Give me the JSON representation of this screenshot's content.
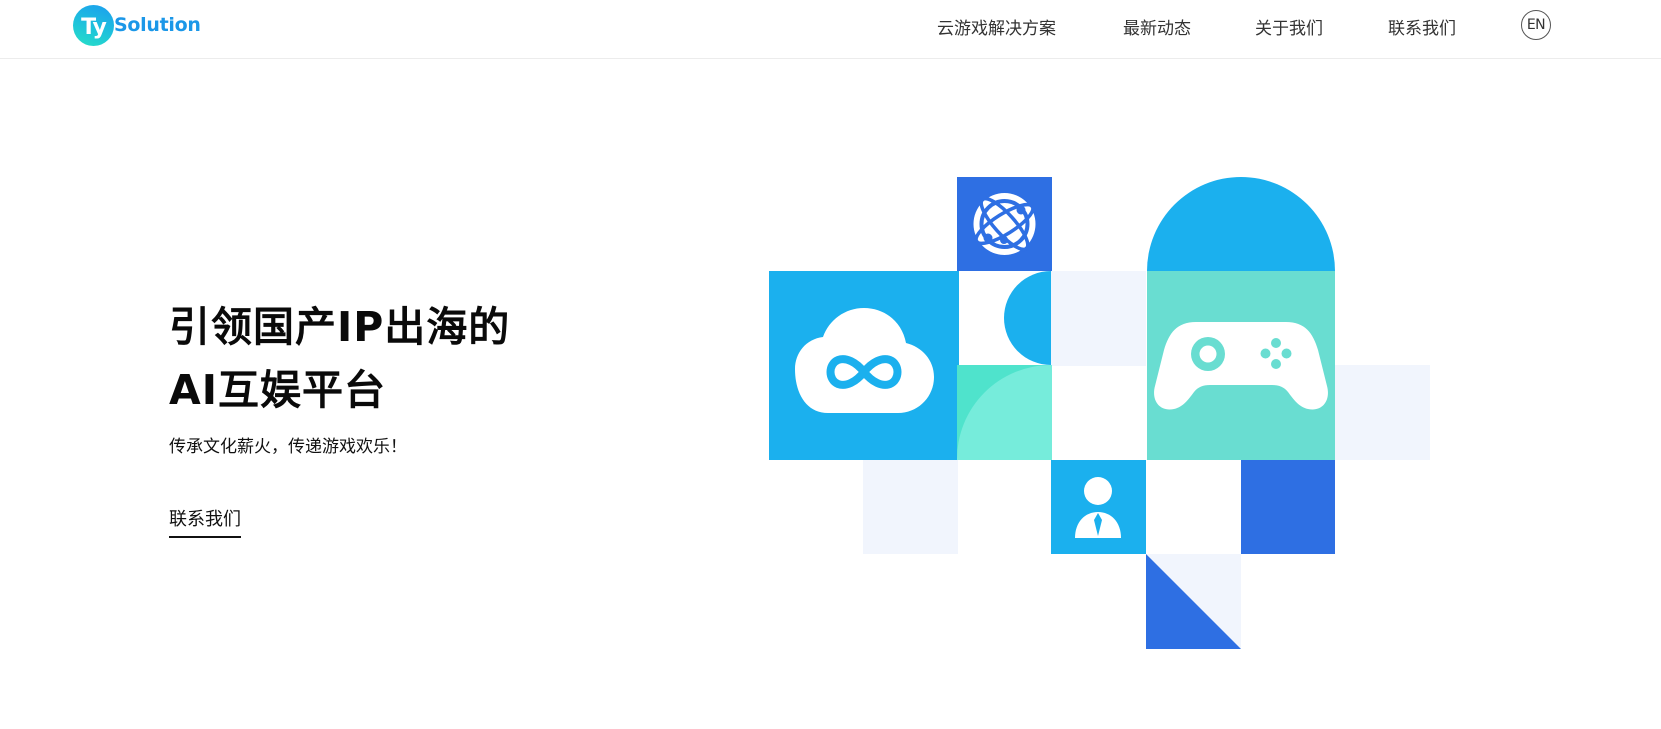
{
  "header": {
    "logo": {
      "badge": "Ty",
      "name": "Solution"
    },
    "nav": [
      {
        "label": "云游戏解决方案"
      },
      {
        "label": "最新动态"
      },
      {
        "label": "关于我们"
      },
      {
        "label": "联系我们"
      }
    ],
    "language_button": "EN"
  },
  "hero": {
    "title_line1": "引领国产IP出海的",
    "title_line2": "AI互娱平台",
    "subtitle": "传承文化薪火，传递游戏欢乐！",
    "cta_label": "联系我们"
  },
  "illustration": {
    "icons": [
      "globe-icon",
      "cloud-infinity-icon",
      "gamepad-icon",
      "person-icon"
    ],
    "colors": {
      "sky_blue": "#1bb0ee",
      "royal_blue": "#2e6fe3",
      "mint": "#69ddd1",
      "mint_light": "#76ecdb",
      "pale": "#f1f5fd"
    }
  }
}
